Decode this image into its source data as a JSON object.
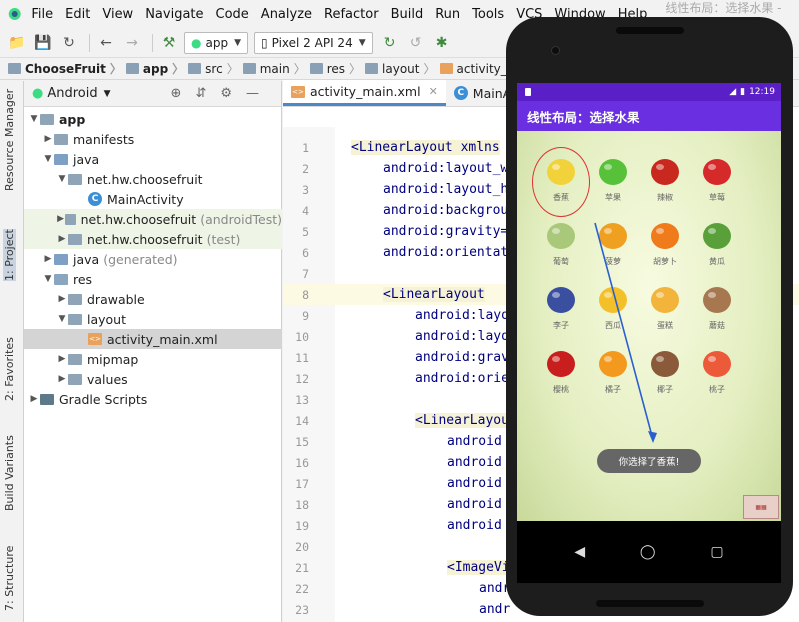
{
  "menu": {
    "items": [
      "File",
      "Edit",
      "View",
      "Navigate",
      "Code",
      "Analyze",
      "Refactor",
      "Build",
      "Run",
      "Tools",
      "VCS",
      "Window",
      "Help"
    ],
    "window_title": "线性布局：选择水果 - ...\\activity"
  },
  "toolbar": {
    "module": "app",
    "device": "Pixel 2 API 24"
  },
  "breadcrumbs": [
    "ChooseFruit",
    "app",
    "src",
    "main",
    "res",
    "layout",
    "activity_main.xm"
  ],
  "side_tabs": {
    "resource_manager": "Resource Manager",
    "project": "1: Project",
    "favorites": "2: Favorites",
    "build_variants": "Build Variants",
    "structure": "7: Structure"
  },
  "project": {
    "view_mode": "Android",
    "tree": [
      {
        "label": "app",
        "note": "",
        "bold": true
      },
      {
        "label": "manifests",
        "note": ""
      },
      {
        "label": "java",
        "note": ""
      },
      {
        "label": "net.hw.choosefruit",
        "note": ""
      },
      {
        "label": "MainActivity",
        "note": ""
      },
      {
        "label": "net.hw.choosefruit",
        "note": "(androidTest)"
      },
      {
        "label": "net.hw.choosefruit",
        "note": "(test)"
      },
      {
        "label": "java",
        "note": "(generated)"
      },
      {
        "label": "res",
        "note": ""
      },
      {
        "label": "drawable",
        "note": ""
      },
      {
        "label": "layout",
        "note": ""
      },
      {
        "label": "activity_main.xml",
        "note": ""
      },
      {
        "label": "mipmap",
        "note": ""
      },
      {
        "label": "values",
        "note": ""
      },
      {
        "label": "Gradle Scripts",
        "note": ""
      }
    ]
  },
  "editor": {
    "tabs": [
      "activity_main.xml",
      "MainActi"
    ],
    "lines": [
      {
        "n": "1",
        "text": "<LinearLayout xmlns"
      },
      {
        "n": "2",
        "text": "android:layout_w"
      },
      {
        "n": "3",
        "text": "android:layout_h"
      },
      {
        "n": "4",
        "text": "android:backgrou"
      },
      {
        "n": "5",
        "text": "android:gravity="
      },
      {
        "n": "6",
        "text": "android:orientat"
      },
      {
        "n": "7",
        "text": ""
      },
      {
        "n": "8",
        "text": "<LinearLayout"
      },
      {
        "n": "9",
        "text": "android:layo"
      },
      {
        "n": "10",
        "text": "android:layo"
      },
      {
        "n": "11",
        "text": "android:grav"
      },
      {
        "n": "12",
        "text": "android:orie"
      },
      {
        "n": "13",
        "text": ""
      },
      {
        "n": "14",
        "text": "<LinearLayou"
      },
      {
        "n": "15",
        "text": "android"
      },
      {
        "n": "16",
        "text": "android"
      },
      {
        "n": "17",
        "text": "android"
      },
      {
        "n": "18",
        "text": "android"
      },
      {
        "n": "19",
        "text": "android"
      },
      {
        "n": "20",
        "text": ""
      },
      {
        "n": "21",
        "text": "<ImageVi"
      },
      {
        "n": "22",
        "text": "andr"
      },
      {
        "n": "23",
        "text": "andr"
      }
    ]
  },
  "emulator": {
    "time": "12:19",
    "app_title": "线性布局：选择水果",
    "fruits": [
      {
        "name": "香蕉",
        "icon": "banana-icon",
        "color": "#f2d23a"
      },
      {
        "name": "苹果",
        "icon": "apple-icon",
        "color": "#57c13a"
      },
      {
        "name": "辣椒",
        "icon": "chili-icon",
        "color": "#c8281e"
      },
      {
        "name": "草莓",
        "icon": "strawberry-icon",
        "color": "#d62a2a"
      },
      {
        "name": "葡萄",
        "icon": "grape-icon",
        "color": "#a9c87a"
      },
      {
        "name": "菠萝",
        "icon": "pineapple-icon",
        "color": "#f0a020"
      },
      {
        "name": "胡萝卜",
        "icon": "carrot-icon",
        "color": "#ef7b1a"
      },
      {
        "name": "黄瓜",
        "icon": "cucumber-icon",
        "color": "#5aa03a"
      },
      {
        "name": "李子",
        "icon": "plum-icon",
        "color": "#3a4fa0"
      },
      {
        "name": "西瓜",
        "icon": "watermelon-icon",
        "color": "#f4c02a"
      },
      {
        "name": "蛋糕",
        "icon": "cake-icon",
        "color": "#f2b43a"
      },
      {
        "name": "蘑菇",
        "icon": "mushroom-icon",
        "color": "#a77850"
      },
      {
        "name": "樱桃",
        "icon": "cherry-icon",
        "color": "#c81e1e"
      },
      {
        "name": "橘子",
        "icon": "orange-icon",
        "color": "#f39a1e"
      },
      {
        "name": "椰子",
        "icon": "coconut-icon",
        "color": "#8a5a3a"
      },
      {
        "name": "桃子",
        "icon": "peach-icon",
        "color": "#ec5a3a"
      }
    ],
    "toast": "你选择了香蕉!"
  },
  "colors": {
    "accent": "#4a88c7",
    "appbar": "#6a2fe0",
    "statusbar": "#5b1fc8"
  }
}
